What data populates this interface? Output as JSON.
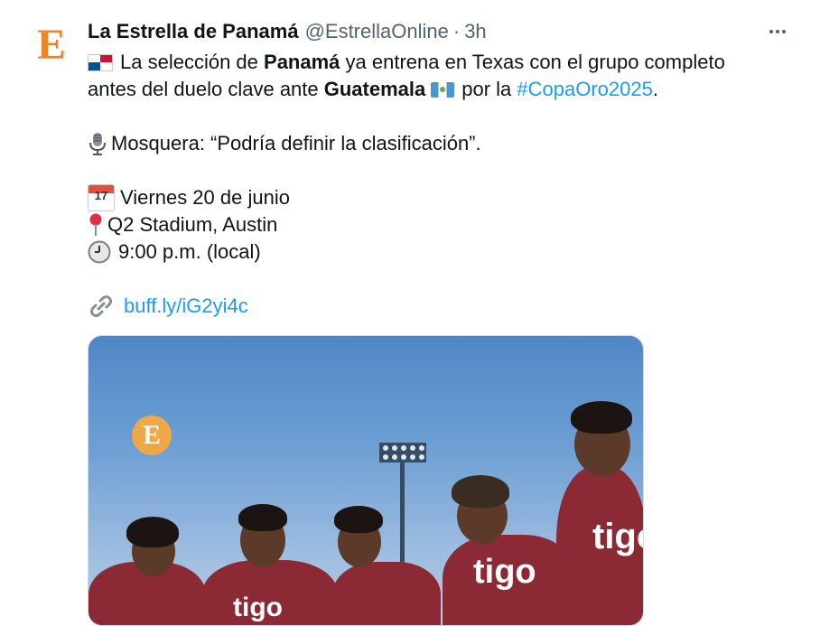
{
  "tweet": {
    "display_name": "La Estrella de Panamá",
    "handle": "@EstrellaOnline",
    "separator": "·",
    "time": "3h",
    "avatar_letter": "E",
    "lines": {
      "l1_pre": "La selección de ",
      "l1_bold": "Panamá",
      "l1_post": " ya entrena en Texas con el grupo completo",
      "l2_pre": "antes del duelo clave ante ",
      "l2_bold": "Guatemala",
      "l2_mid": "por la ",
      "l2_hashtag": "#CopaOro2025",
      "l2_end": ".",
      "l3": "Mosquera: “Podría definir la clasificación”.",
      "l4": "Viernes 20 de junio",
      "l5": "Q2 Stadium, Austin",
      "l6": "9:00 p.m. (local)",
      "link": "buff.ly/iG2yi4c"
    },
    "calendar_day": "17",
    "media": {
      "logo_letter": "E",
      "sponsor": "tigo"
    }
  },
  "icons": [
    "more-icon",
    "panama-flag-icon",
    "guatemala-flag-icon",
    "microphone-icon",
    "calendar-icon",
    "pin-icon",
    "clock-icon",
    "link-icon"
  ],
  "colors": {
    "link": "#1d9bf0",
    "secondary_text": "#536471",
    "brand_orange": "#e8862a",
    "jersey": "#8b2a35"
  }
}
